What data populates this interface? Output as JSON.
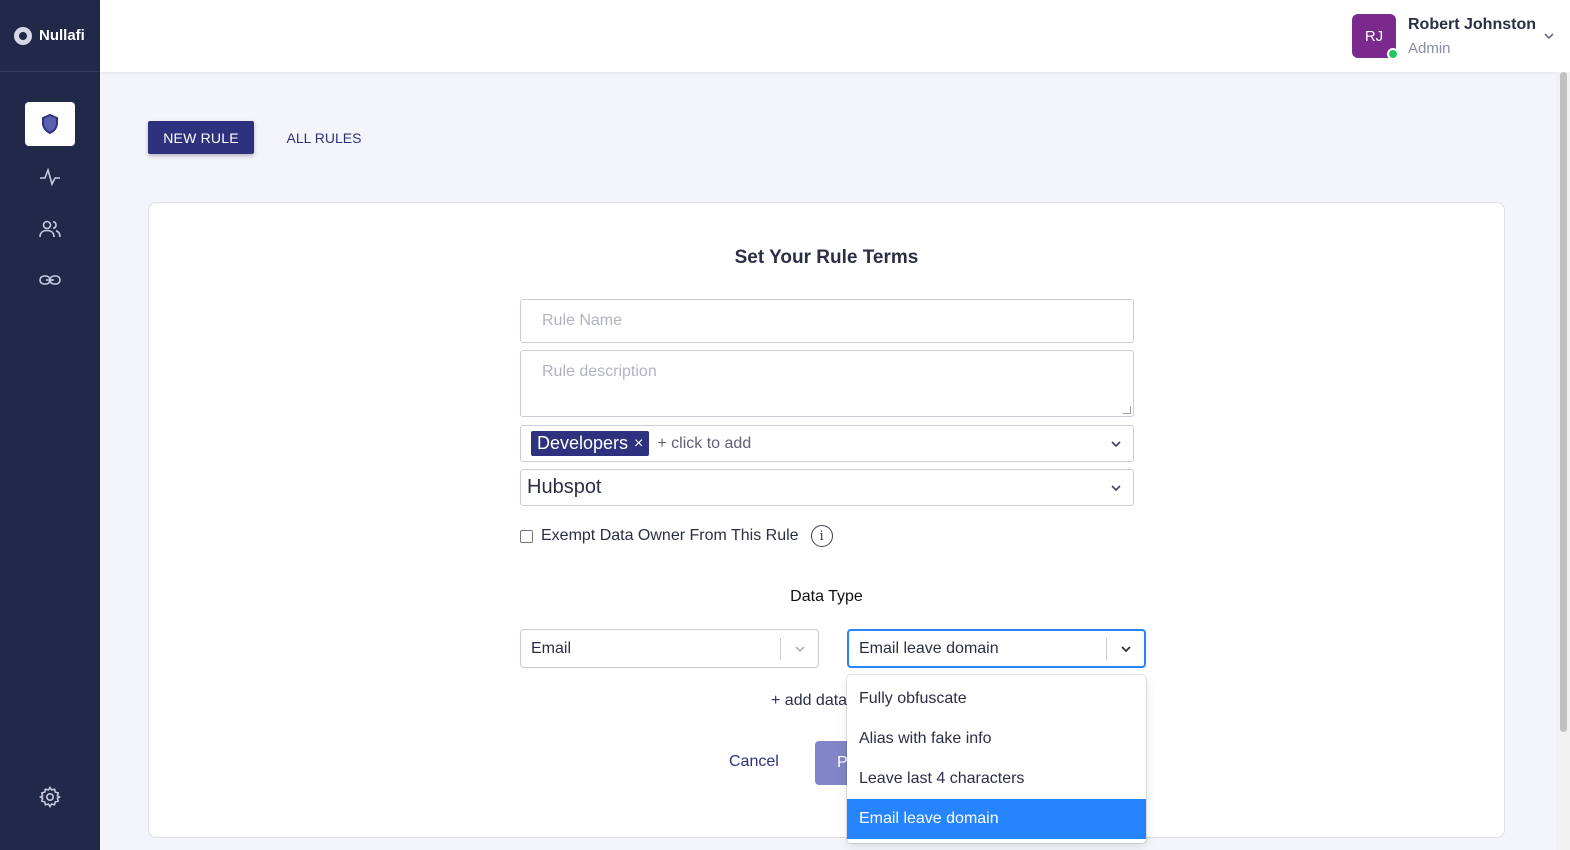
{
  "app": {
    "name": "Nullafi"
  },
  "sidebar": {
    "items": [
      {
        "icon": "shield-icon",
        "active": true
      },
      {
        "icon": "activity-icon",
        "active": false
      },
      {
        "icon": "users-icon",
        "active": false
      },
      {
        "icon": "link-icon",
        "active": false
      },
      {
        "icon": "gear-icon",
        "active": false
      }
    ]
  },
  "user": {
    "initials": "RJ",
    "name": "Robert Johnston",
    "role": "Admin",
    "status_color": "#22c55e"
  },
  "tabs": {
    "new_rule": "NEW RULE",
    "all_rules": "ALL RULES"
  },
  "form": {
    "title": "Set Your Rule Terms",
    "rule_name_placeholder": "Rule Name",
    "rule_description_placeholder": "Rule description",
    "groups": {
      "tags": [
        "Developers"
      ],
      "add_text": "+ click to add"
    },
    "app": "Hubspot",
    "exempt_label": "Exempt Data Owner From This Rule",
    "exempt_checked": false,
    "data_type_label": "Data Type",
    "data_type_value": "Email",
    "method_value": "Email leave domain",
    "add_data_label": "+ add data",
    "cancel_label": "Cancel",
    "primary_label": "P"
  },
  "method_menu": {
    "options": [
      "Fully obfuscate",
      "Alias with fake info",
      "Leave last 4 characters",
      "Email leave domain"
    ],
    "selected_index": 3
  },
  "colors": {
    "sidebar": "#222848",
    "accent": "#2e327e",
    "focus": "#2684ff",
    "avatar": "#7a2a8c"
  }
}
